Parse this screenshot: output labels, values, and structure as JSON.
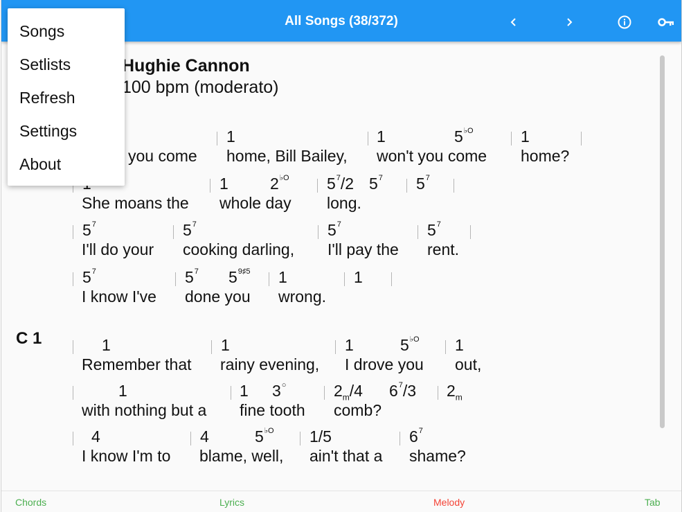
{
  "appbar": {
    "title": "All Songs (38/372)",
    "icons": [
      "chevron-left-icon",
      "chevron-right-icon",
      "info-icon",
      "key-icon"
    ]
  },
  "menu": {
    "items": [
      "Songs",
      "Setlists",
      "Refresh",
      "Settings",
      "About"
    ]
  },
  "song": {
    "author": "Hughie Cannon",
    "tempo": "100 bpm (moderato)",
    "section_label": "C 1"
  },
  "lines": [
    {
      "chords": [
        [
          "1",
          ""
        ],
        [
          "1",
          ""
        ],
        [
          "5",
          "♭O"
        ],
        [
          "1",
          ""
        ]
      ],
      "lyrics": [
        "you come",
        "home, Bill Bailey,",
        "won't you come",
        "home?"
      ]
    },
    {
      "chords": [
        [
          "1",
          ""
        ],
        [
          "1",
          ""
        ],
        [
          "2",
          "♭O"
        ],
        [
          "5/2",
          "7"
        ],
        [
          "5",
          "7"
        ],
        [
          "5",
          "7"
        ]
      ],
      "lyrics": [
        "She moans the",
        "whole day",
        "long."
      ]
    },
    {
      "chords": [
        [
          "5",
          "7"
        ],
        [
          "5",
          "7"
        ],
        [
          "5",
          "7"
        ],
        [
          "5",
          "7"
        ]
      ],
      "lyrics": [
        "I'll do your",
        "cooking darling,",
        "I'll pay the",
        "rent."
      ]
    },
    {
      "chords": [
        [
          "5",
          "7"
        ],
        [
          "5",
          "7"
        ],
        [
          "5",
          "9♯5"
        ],
        [
          "1",
          ""
        ],
        [
          "1",
          ""
        ]
      ],
      "lyrics": [
        "I know I've",
        "done you",
        "wrong."
      ]
    },
    {
      "chords": [
        [
          "1",
          ""
        ],
        [
          "1",
          ""
        ],
        [
          "1",
          ""
        ],
        [
          "5",
          "♭O"
        ],
        [
          "1",
          ""
        ]
      ],
      "lyrics": [
        "Remember that",
        "rainy evening,",
        "I drove you",
        "out,"
      ]
    },
    {
      "chords": [
        [
          "1",
          ""
        ],
        [
          "1",
          ""
        ],
        [
          "3",
          "○"
        ],
        [
          "2m/4",
          ""
        ],
        [
          "6/3",
          "7"
        ],
        [
          "2m",
          ""
        ]
      ],
      "lyrics": [
        "with nothing but a",
        "fine tooth",
        "comb?"
      ]
    },
    {
      "chords": [
        [
          "4",
          ""
        ],
        [
          "4",
          ""
        ],
        [
          "5",
          "♭O"
        ],
        [
          "1/5",
          ""
        ],
        [
          "6",
          "7"
        ]
      ],
      "lyrics": [
        "I know I'm to",
        "blame, well,",
        "ain't that a",
        "shame?"
      ]
    }
  ],
  "tabs": [
    {
      "label": "Chords",
      "color": "#4caf50"
    },
    {
      "label": "Lyrics",
      "color": "#4caf50"
    },
    {
      "label": "Melody",
      "color": "#f44336"
    },
    {
      "label": "Tab",
      "color": "#4caf50"
    }
  ],
  "colors": {
    "appbar": "#2196f3"
  }
}
